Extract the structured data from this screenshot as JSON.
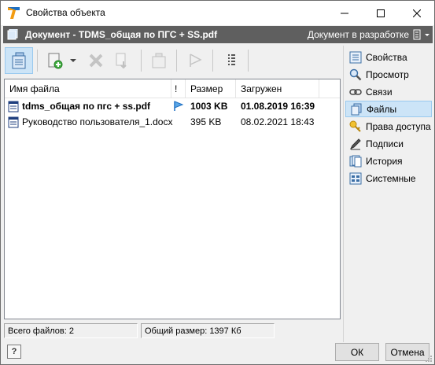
{
  "window": {
    "title": "Свойства объекта"
  },
  "document": {
    "title": "Документ - TDMS_общая по ПГС + SS.pdf",
    "status": "Документ в разработке"
  },
  "file_list": {
    "columns": [
      "Имя файла",
      "!",
      "Размер",
      "Загружен"
    ],
    "rows": [
      {
        "name": "tdms_общая по пгс + ss.pdf",
        "flag": "blue-flag-icon",
        "size": "1003 KB",
        "uploaded": "01.08.2019 16:39",
        "bold": true
      },
      {
        "name": "Руководство пользователя_1.docx",
        "flag": "",
        "size": "395 KB",
        "uploaded": "08.02.2021 18:43",
        "bold": false
      }
    ]
  },
  "status_bar": {
    "total_files": "Всего файлов: 2",
    "total_size": "Общий размер: 1397 Кб"
  },
  "nav": {
    "items": [
      {
        "label": "Свойства",
        "icon": "properties-icon"
      },
      {
        "label": "Просмотр",
        "icon": "magnifier-icon"
      },
      {
        "label": "Связи",
        "icon": "link-icon"
      },
      {
        "label": "Файлы",
        "icon": "files-icon"
      },
      {
        "label": "Права доступа",
        "icon": "key-icon"
      },
      {
        "label": "Подписи",
        "icon": "signature-icon"
      },
      {
        "label": "История",
        "icon": "history-icon"
      },
      {
        "label": "Системные",
        "icon": "system-icon"
      }
    ],
    "active": "Файлы"
  },
  "toolbar": {
    "buttons": [
      "files-view-icon",
      "add-file-icon",
      "dropdown-arrow-icon",
      "delete-icon",
      "export-icon",
      "copy-icon",
      "flag-icon",
      "columns-icon"
    ]
  },
  "buttons": {
    "help": "?",
    "ok": "ОК",
    "cancel": "Отмена"
  },
  "colors": {
    "docbar_bg": "#5f5f5f",
    "active_bg": "#cce4f7",
    "accent_blue": "#1e6fc2"
  }
}
